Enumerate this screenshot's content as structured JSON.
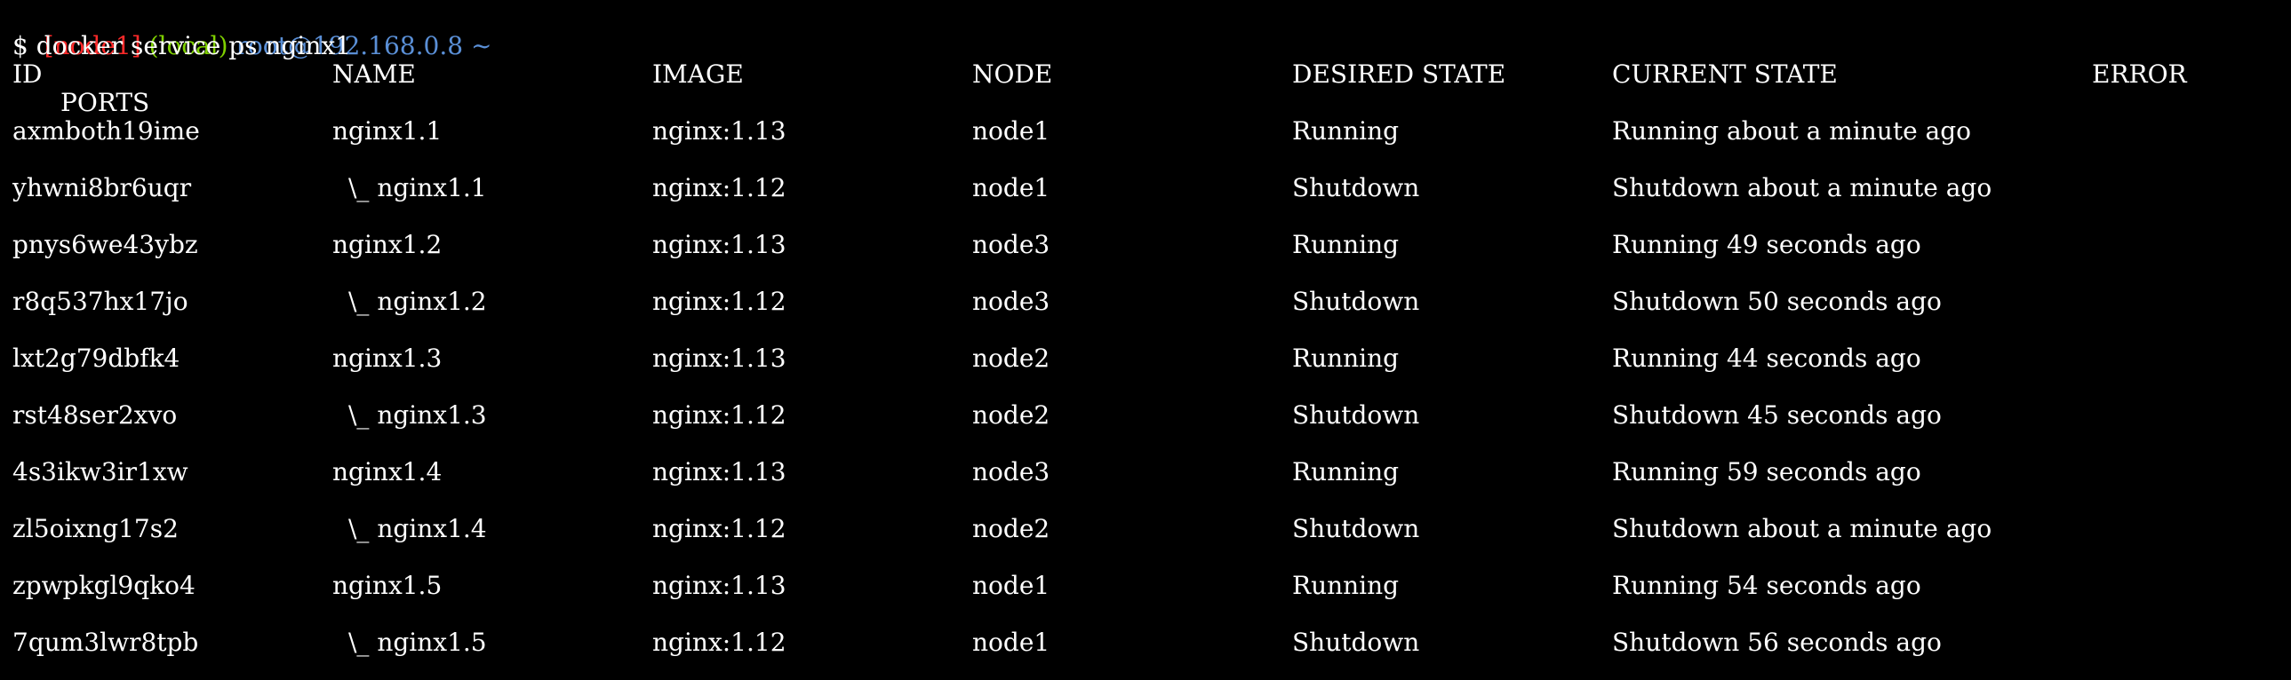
{
  "prompt": {
    "node_tag": "[node1]",
    "local_tag": "(local)",
    "host": "root@192.168.0.8 ~"
  },
  "command": "$ docker service ps nginx1",
  "headers": {
    "id": "ID",
    "name": "NAME",
    "image": "IMAGE",
    "node": "NODE",
    "desired_state": "DESIRED STATE",
    "current_state": "CURRENT STATE",
    "error": "ERROR",
    "ports": "PORTS"
  },
  "rows": [
    {
      "id": "axmboth19ime",
      "name": "nginx1.1",
      "image": "nginx:1.13",
      "node": "node1",
      "desired": "Running",
      "current": "Running about a minute ago"
    },
    {
      "id": "yhwni8br6uqr",
      "name": "\\_ nginx1.1",
      "image": "nginx:1.12",
      "node": "node1",
      "desired": "Shutdown",
      "current": "Shutdown about a minute ago"
    },
    {
      "id": "pnys6we43ybz",
      "name": "nginx1.2",
      "image": "nginx:1.13",
      "node": "node3",
      "desired": "Running",
      "current": "Running 49 seconds ago"
    },
    {
      "id": "r8q537hx17jo",
      "name": "\\_ nginx1.2",
      "image": "nginx:1.12",
      "node": "node3",
      "desired": "Shutdown",
      "current": "Shutdown 50 seconds ago"
    },
    {
      "id": "lxt2g79dbfk4",
      "name": "nginx1.3",
      "image": "nginx:1.13",
      "node": "node2",
      "desired": "Running",
      "current": "Running 44 seconds ago"
    },
    {
      "id": "rst48ser2xvo",
      "name": "\\_ nginx1.3",
      "image": "nginx:1.12",
      "node": "node2",
      "desired": "Shutdown",
      "current": "Shutdown 45 seconds ago"
    },
    {
      "id": "4s3ikw3ir1xw",
      "name": "nginx1.4",
      "image": "nginx:1.13",
      "node": "node3",
      "desired": "Running",
      "current": "Running 59 seconds ago"
    },
    {
      "id": "zl5oixng17s2",
      "name": "\\_ nginx1.4",
      "image": "nginx:1.12",
      "node": "node2",
      "desired": "Shutdown",
      "current": "Shutdown about a minute ago"
    },
    {
      "id": "zpwpkgl9qko4",
      "name": "nginx1.5",
      "image": "nginx:1.13",
      "node": "node1",
      "desired": "Running",
      "current": "Running 54 seconds ago"
    },
    {
      "id": "7qum3lwr8tpb",
      "name": "\\_ nginx1.5",
      "image": "nginx:1.12",
      "node": "node1",
      "desired": "Shutdown",
      "current": "Shutdown 56 seconds ago"
    }
  ],
  "colors": {
    "background": "#000000",
    "text": "#ffffff",
    "node_tag": "#ff2a2a",
    "local_tag": "#7fd000",
    "host": "#5a8fd6"
  }
}
